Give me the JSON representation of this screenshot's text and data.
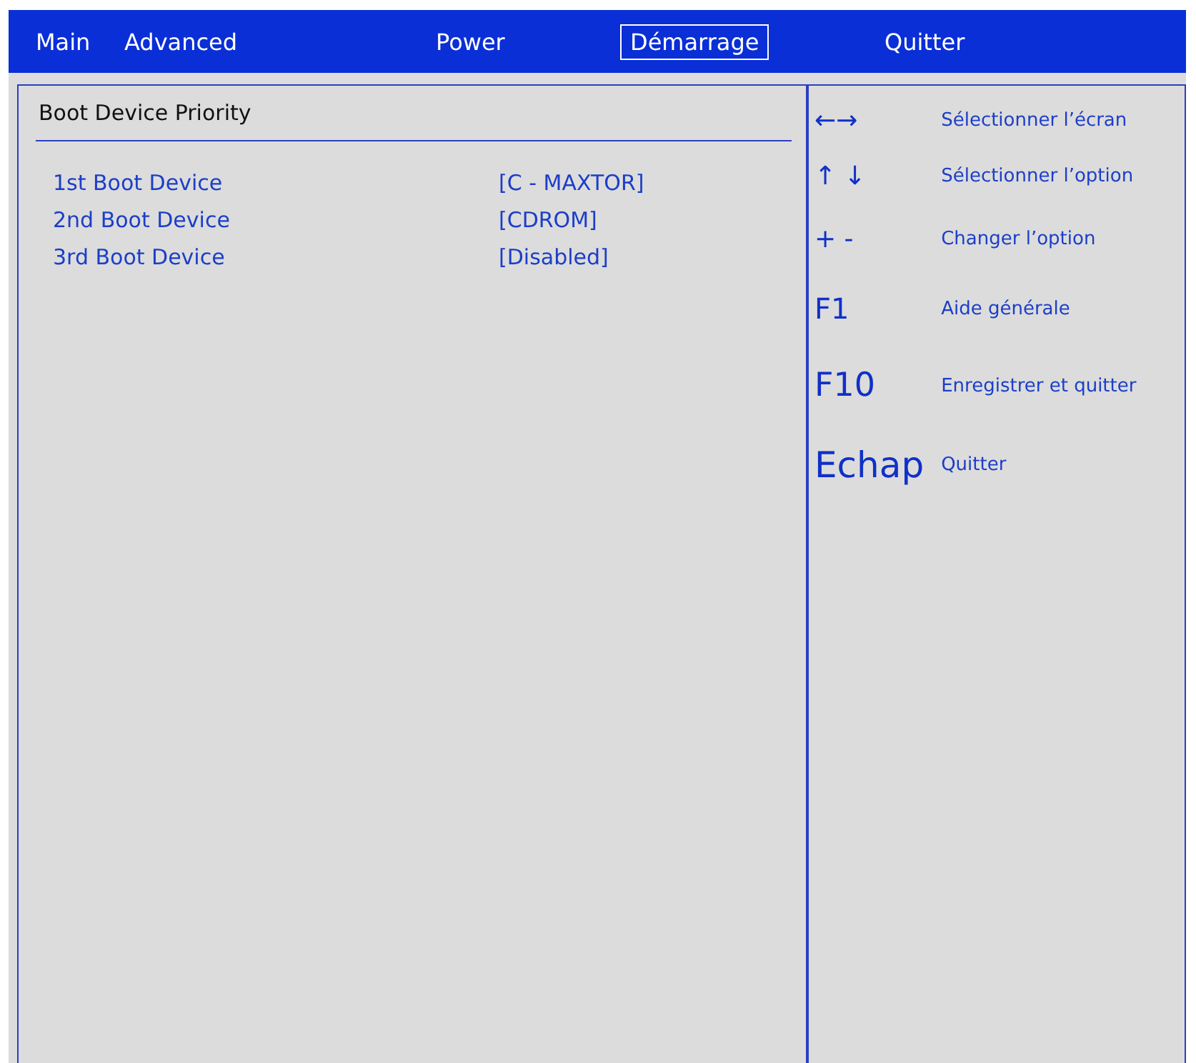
{
  "menu_bar": {
    "tabs": [
      {
        "label": "Main",
        "selected": false
      },
      {
        "label": "Advanced",
        "selected": false
      },
      {
        "label": "Power",
        "selected": false
      },
      {
        "label": "Démarrage",
        "selected": true
      },
      {
        "label": "Quitter",
        "selected": false
      }
    ]
  },
  "settings_panel": {
    "title": "Boot Device Priority",
    "items": [
      {
        "label": "1st Boot Device",
        "value": "[C - MAXTOR]"
      },
      {
        "label": "2nd Boot Device",
        "value": "[CDROM]"
      },
      {
        "label": "3rd Boot Device",
        "value": "[Disabled]"
      }
    ]
  },
  "help_panel": {
    "keys": [
      {
        "key": "←→",
        "action": "Sélectionner l’écran",
        "kind": "arrow"
      },
      {
        "key": "↑ ↓",
        "action": "Sélectionner l’option",
        "kind": "arrow"
      },
      {
        "key": "+ -",
        "action": "Changer l’option",
        "kind": "arrow"
      },
      {
        "key": "F1",
        "action": "Aide générale",
        "kind": "small"
      },
      {
        "key": "F10",
        "action": "Enregistrer et quitter",
        "kind": "medium"
      },
      {
        "key": "Echap",
        "action": "Quitter",
        "kind": "large"
      }
    ]
  }
}
